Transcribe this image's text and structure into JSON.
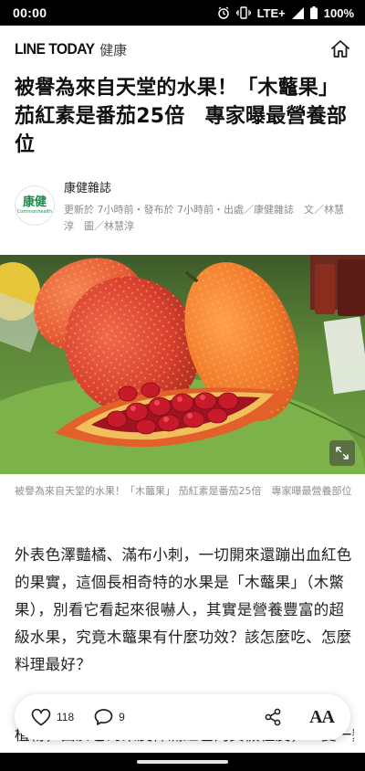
{
  "status_bar": {
    "time": "00:00",
    "network": "LTE+",
    "battery": "100%"
  },
  "header": {
    "logo": "LINE TODAY",
    "category": "健康"
  },
  "article": {
    "headline": "被譽為來自天堂的水果！「木虌果」 茄紅素是番茄25倍　專家曝最營養部位",
    "source_name": "康健雜誌",
    "source_logo_text": "康健",
    "source_logo_subtext": "Commonhealth",
    "meta": "更新於 7小時前・發布於 7小時前・出處／康健雜誌　文／林慧淳　圖／林慧淳",
    "image_caption": "被譽為來自天堂的水果！「木虌果」 茄紅素是番茄25倍　專家曝最營養部位",
    "paragraph_1": "外表色澤豔橘、滿布小刺，一切開來還蹦出血紅色的果實，這個長相奇特的水果是「木虌果」（木鱉果），別看它看起來很嚇人，其實是營養豐富的超級水果，究竟木虌果有什麼功效？該怎麼吃、怎麼料理最好？",
    "paragraph_2": "植物，由於它的果皮佈滿紅色肉質假種皮，一變一變的小"
  },
  "actions": {
    "like_count": "118",
    "comment_count": "9",
    "font_size_label": "AA"
  }
}
